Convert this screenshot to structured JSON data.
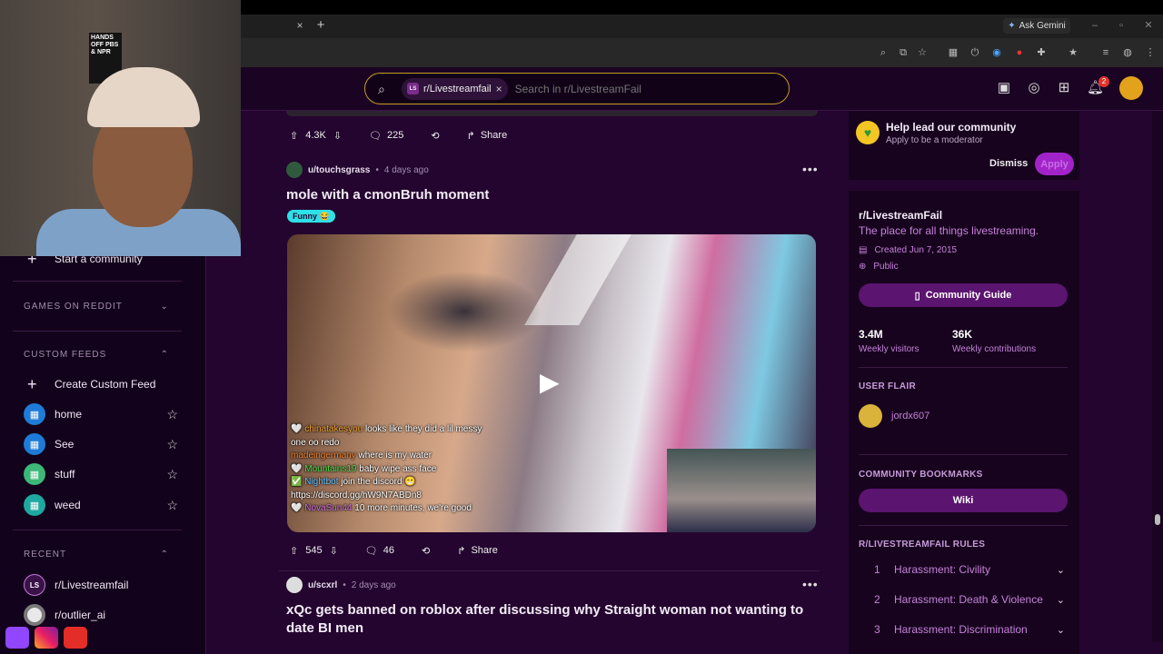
{
  "browser": {
    "new_tab": "+",
    "tab_close": "×",
    "ask_gemini": "Ask Gemini"
  },
  "header": {
    "search_chip": "r/Livestreamfail",
    "search_placeholder": "Search in r/LivestreamFail",
    "notification_count": "2"
  },
  "sidebar": {
    "start_community": "Start a community",
    "games_section": "GAMES ON REDDIT",
    "custom_feeds_section": "CUSTOM FEEDS",
    "create_feed": "Create Custom Feed",
    "feeds": [
      {
        "label": "home"
      },
      {
        "label": "See"
      },
      {
        "label": "stuff"
      },
      {
        "label": "weed"
      }
    ],
    "recent_section": "RECENT",
    "recent": [
      {
        "label": "r/Livestreamfail"
      },
      {
        "label": "r/outlier_ai"
      }
    ]
  },
  "posts": [
    {
      "votes": "4.3K",
      "comments": "225",
      "share": "Share"
    },
    {
      "username": "u/touchsgrass",
      "time": "4 days ago",
      "title": "mole with a cmonBruh moment",
      "flair": "Funny",
      "votes": "545",
      "comments": "46",
      "share": "Share",
      "chat": [
        {
          "name": "chinatakesyou",
          "msg": "looks like they did a lil messy one oo redo"
        },
        {
          "name": "madeingermany",
          "msg": "where is my water"
        },
        {
          "name": "Mountains19",
          "msg": "baby wipe ass face"
        },
        {
          "name": "Nightbot",
          "msg": "join the discord 😁 https://discord.gg/hW9N7ABDn8"
        },
        {
          "name": "NovaSun44",
          "msg": "10 more minutes, we're good"
        }
      ]
    },
    {
      "username": "u/scxrl",
      "time": "2 days ago",
      "title": "xQc gets banned on roblox after discussing why Straight woman not wanting to date BI men"
    }
  ],
  "right": {
    "mod_title": "Help lead our community",
    "mod_sub": "Apply to be a moderator",
    "dismiss": "Dismiss",
    "apply": "Apply",
    "sub_name": "r/LivestreamFail",
    "sub_desc": "The place for all things livestreaming.",
    "created": "Created Jun 7, 2015",
    "visibility": "Public",
    "guide": "Community Guide",
    "stats": [
      {
        "value": "3.4M",
        "label": "Weekly visitors"
      },
      {
        "value": "36K",
        "label": "Weekly contributions"
      }
    ],
    "user_flair_h": "USER FLAIR",
    "user_flair": "jordx607",
    "bookmarks_h": "COMMUNITY BOOKMARKS",
    "wiki": "Wiki",
    "rules_h": "R/LIVESTREAMFAIL RULES",
    "rules": [
      {
        "num": "1",
        "label": "Harassment: Civility"
      },
      {
        "num": "2",
        "label": "Harassment: Death & Violence"
      },
      {
        "num": "3",
        "label": "Harassment: Discrimination"
      }
    ]
  },
  "webcam": {
    "sign_text": "HANDS OFF PBS & NPR"
  },
  "colors": {
    "accent": "#5b1470",
    "feed_bg": "#24052f",
    "link": "#c583d9"
  }
}
